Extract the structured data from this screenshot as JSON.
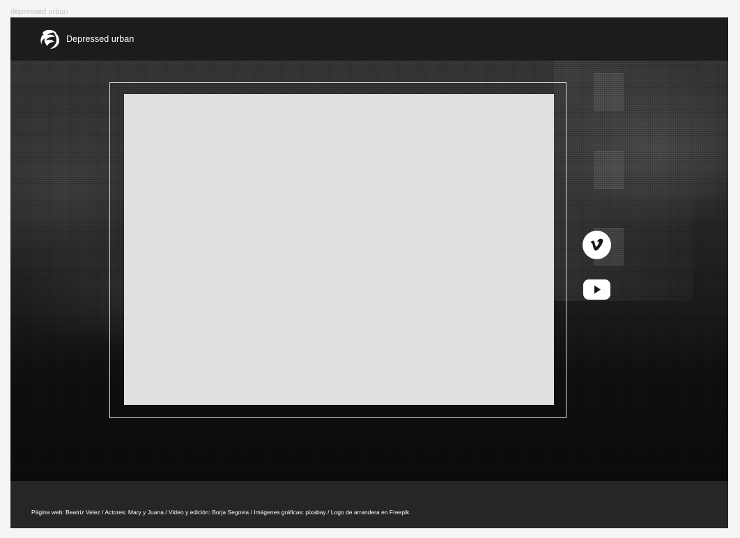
{
  "canvas": {
    "frame_label": "depressed urban"
  },
  "header": {
    "logo_icon": "flag-swirl-logo-icon",
    "brand_name": "Depressed urban"
  },
  "hero": {
    "video": {
      "placeholder_color": "#e0e0e0"
    },
    "social_links": [
      {
        "name": "vimeo",
        "icon": "vimeo-icon"
      },
      {
        "name": "youtube",
        "icon": "youtube-icon"
      }
    ]
  },
  "footer": {
    "credits": "Página web: Beatriz Velez / Actores: Mary y Juana / Video y edición: Borja Segovia / Imágenes gráficas: pixabay / Logo de arrandera en Freepik"
  },
  "colors": {
    "header_bg": "#1c1c1c",
    "footer_bg": "#262626",
    "text": "#ffffff"
  }
}
